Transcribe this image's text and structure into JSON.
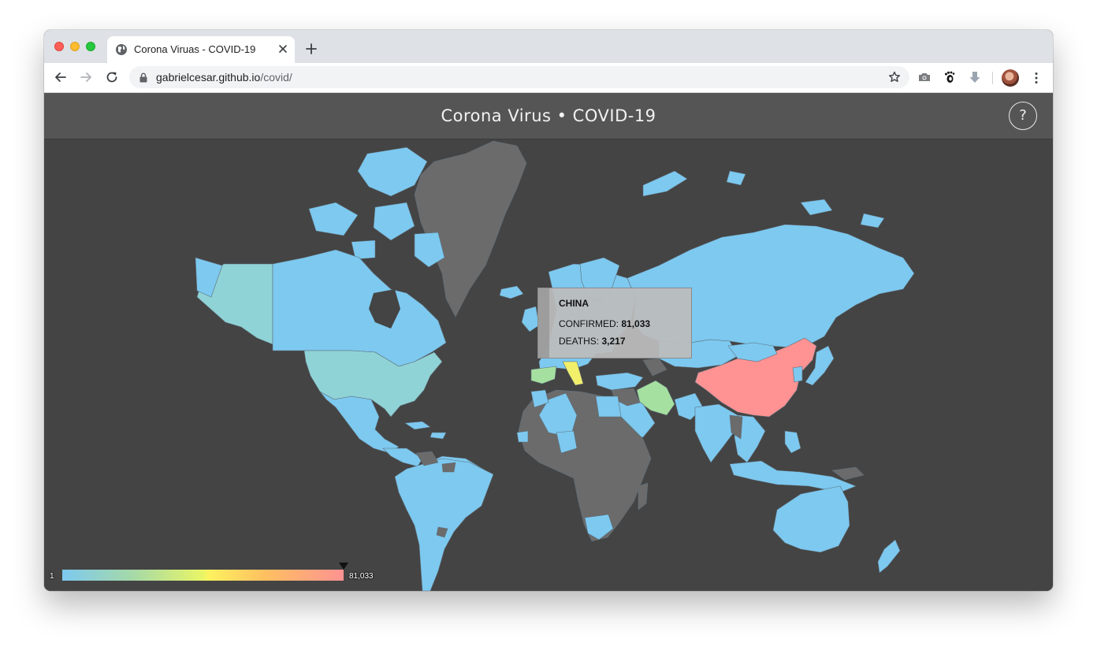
{
  "browser": {
    "tab_title": "Corona Viruas - COVID-19",
    "url_host": "gabrielcesar.github.io",
    "url_path": "/covid/"
  },
  "page": {
    "title": "Corona Virus • COVID-19",
    "help_label": "?"
  },
  "tooltip": {
    "country": "CHINA",
    "confirmed_label": "CONFIRMED:",
    "confirmed_value": "81,033",
    "deaths_label": "DEATHS:",
    "deaths_value": "3,217"
  },
  "legend": {
    "min_label": "1",
    "max_label": "81,033",
    "colors": [
      "#7dc9f0",
      "#a5d9a8",
      "#e9f566",
      "#fdf25f",
      "#fec060",
      "#ff9292"
    ]
  },
  "map_colors": {
    "background": "#444444",
    "no_data": "#6b6b6b",
    "low": "#7dc9f0",
    "medium_low": "#8fd3d6",
    "medium": "#a5e0a0",
    "high": "#f2f06a",
    "max": "#ff9292"
  },
  "icons": {
    "tab_favicon": "globe-icon",
    "tab_close": "close-icon",
    "new_tab": "plus-icon",
    "back": "arrow-left-icon",
    "forward": "arrow-right-icon",
    "reload": "reload-icon",
    "lock": "lock-icon",
    "bookmark": "star-icon",
    "ext_camera": "camera-icon",
    "ext_gnome": "footprint-icon",
    "ext_download": "download-arrow-icon",
    "profile": "avatar",
    "menu": "kebab-menu-icon"
  }
}
